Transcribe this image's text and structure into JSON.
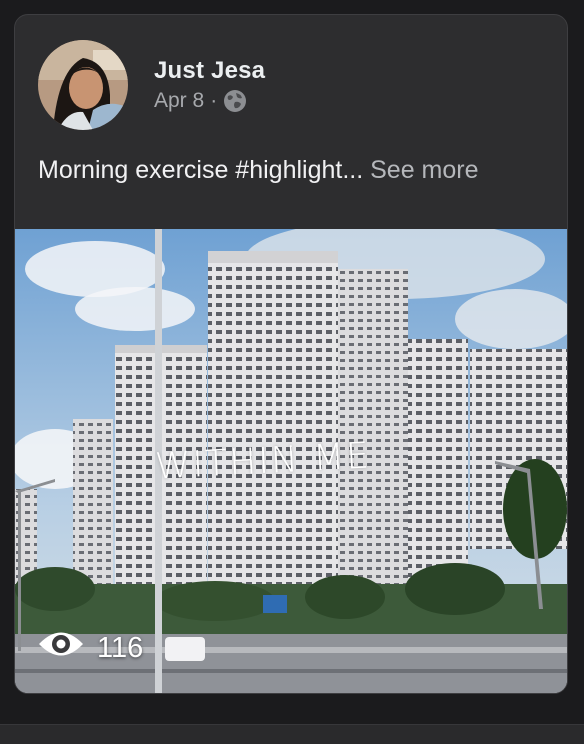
{
  "post": {
    "author": "Just Jesa",
    "date": "Apr 8",
    "separator": "·",
    "audience_icon": "globe-icon",
    "caption_text": "Morning exercise  #highlight...",
    "see_more": "See more",
    "video": {
      "overlay_text": "WITHIN ME",
      "views_icon": "eye-icon",
      "view_count": "116"
    }
  },
  "colors": {
    "card_bg": "#2d2d2f",
    "page_bg": "#1b1b1d",
    "author": "#eceff1",
    "meta": "#a7a9ad",
    "sky": "#8fb7dd",
    "building": "#d9d9db"
  }
}
